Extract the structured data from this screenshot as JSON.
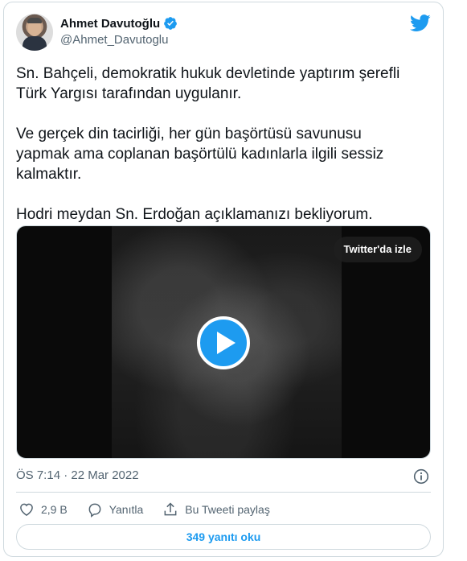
{
  "author": {
    "display_name": "Ahmet Davutoğlu",
    "handle": "@Ahmet_Davutoglu",
    "verified": true
  },
  "tweet": {
    "text": "Sn. Bahçeli, demokratik hukuk devletinde yaptırım şerefli\nTürk Yargısı tarafından uygulanır.\n\nVe gerçek din tacirliği, her gün başörtüsü savunusu\nyapmak ama coplanan başörtülü kadınlarla ilgili sessiz\nkalmaktır.\n\nHodri meydan Sn. Erdoğan açıklamanızı bekliyorum."
  },
  "video": {
    "watch_label": "Twitter'da izle"
  },
  "meta": {
    "timestamp": "ÖS 7:14 · 22 Mar 2022"
  },
  "actions": {
    "likes": "2,9 B",
    "reply_label": "Yanıtla",
    "share_label": "Bu Tweeti paylaş"
  },
  "replies_button": "349 yanıtı oku",
  "colors": {
    "accent": "#1d9bf0",
    "text": "#0f1419",
    "secondary": "#536471",
    "border": "#cfd9de"
  },
  "icons": [
    "verified-badge-icon",
    "twitter-bird-icon",
    "play-icon",
    "info-icon",
    "heart-icon",
    "reply-bubble-icon",
    "share-icon"
  ]
}
